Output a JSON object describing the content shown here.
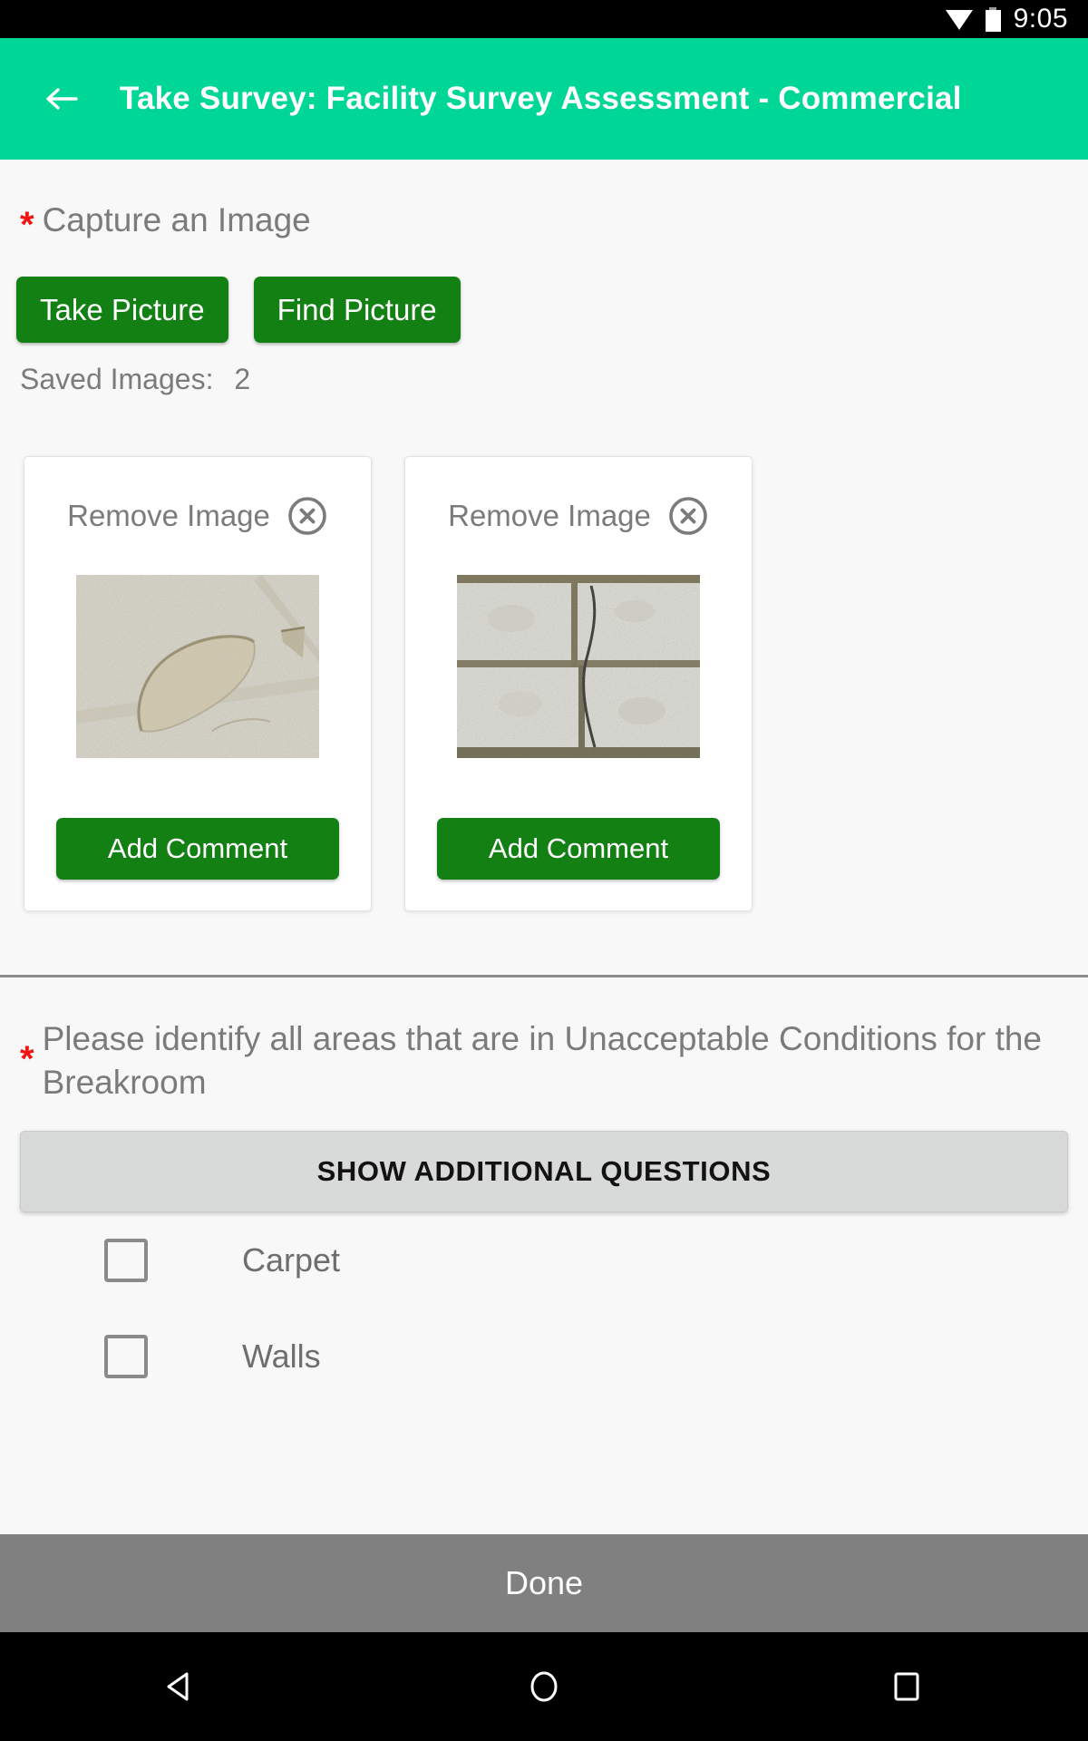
{
  "statusbar": {
    "time": "9:05",
    "wifi_icon": "wifi-icon",
    "battery_icon": "battery-icon"
  },
  "appbar": {
    "back_icon": "arrow-left-icon",
    "title": "Take Survey: Facility Survey Assessment - Commercial",
    "background": "#00d696"
  },
  "question_image": {
    "required_marker": "*",
    "label": "Capture an Image",
    "take_picture_label": "Take Picture",
    "find_picture_label": "Find Picture",
    "saved_images_label": "Saved Images:",
    "saved_images_count": "2",
    "button_color": "#128012",
    "cards": [
      {
        "remove_label": "Remove Image",
        "remove_icon": "close-circle-icon",
        "thumbnail_alt": "stained ceiling tile",
        "comment_label": "Add Comment"
      },
      {
        "remove_label": "Remove Image",
        "remove_icon": "close-circle-icon",
        "thumbnail_alt": "cracked floor tile",
        "comment_label": "Add Comment"
      }
    ]
  },
  "question_areas": {
    "required_marker": "*",
    "label": "Please identify all areas that are in Unacceptable Conditions for the Breakroom",
    "show_additional_label": "SHOW ADDITIONAL QUESTIONS",
    "options": [
      {
        "label": "Carpet",
        "checked": false
      },
      {
        "label": "Walls",
        "checked": false
      }
    ]
  },
  "footer": {
    "done_label": "Done"
  },
  "navbar": {
    "back_icon": "nav-back-icon",
    "home_icon": "nav-home-icon",
    "recents_icon": "nav-recents-icon"
  }
}
